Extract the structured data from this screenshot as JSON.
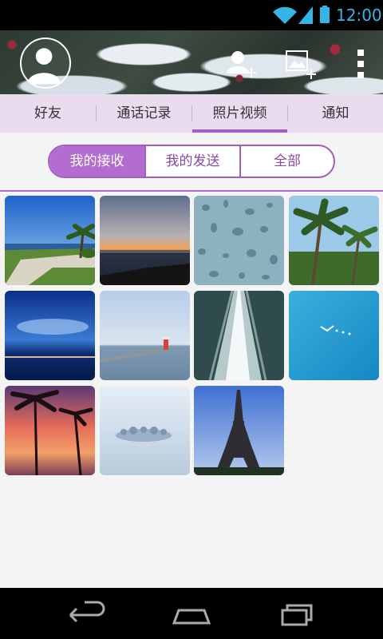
{
  "status_bar": {
    "time": "12:00",
    "accent": "#33b5e5"
  },
  "header": {
    "avatar_icon": "default-user-avatar-icon",
    "actions": [
      "add-friend-icon",
      "add-photo-icon",
      "overflow-menu-icon"
    ]
  },
  "tabs": [
    {
      "label": "好友"
    },
    {
      "label": "通话记录"
    },
    {
      "label": "照片视频",
      "selected": true
    },
    {
      "label": "通知"
    }
  ],
  "segments": [
    {
      "label": "我的接收",
      "selected": true
    },
    {
      "label": "我的发送"
    },
    {
      "label": "全部"
    }
  ],
  "photos": [
    {
      "subject": "coastal road with palm tree"
    },
    {
      "subject": "sunset over sea"
    },
    {
      "subject": "water droplets on glass"
    },
    {
      "subject": "palm trees under sky"
    },
    {
      "subject": "city lights under blue clouds"
    },
    {
      "subject": "pier with lighthouse"
    },
    {
      "subject": "ship wake on ocean"
    },
    {
      "subject": "bird over turquoise water"
    },
    {
      "subject": "palm silhouettes at dusk"
    },
    {
      "subject": "misty trees on lake"
    },
    {
      "subject": "eiffel tower"
    }
  ],
  "nav_bar": {
    "buttons": [
      "back-icon",
      "home-icon",
      "recent-apps-icon"
    ]
  },
  "colors": {
    "accent": "#a35cc4",
    "tab_bg": "#eadcef",
    "page_bg": "#f4f4f4"
  }
}
